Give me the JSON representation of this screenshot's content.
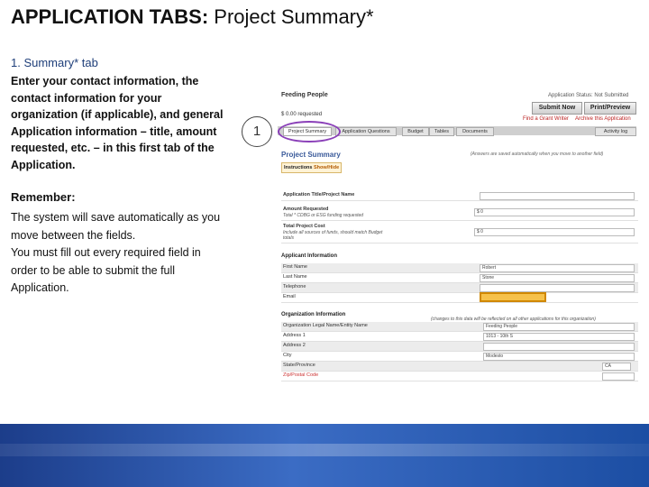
{
  "slide": {
    "title_bold": "APPLICATION TABS:",
    "title_rest": " Project Summary*",
    "subhead": "1. Summary* tab",
    "intro": "Enter your contact information, the contact information for your organization (if applicable), and general Application information – title, amount requested, etc. – in this first tab of the Application.",
    "remember_heading": "Remember:",
    "remember_lines": [
      "The system will save automatically as you move between the fields.",
      "You must fill out every required field in order to be able to submit the full Application."
    ],
    "step_number": "1"
  },
  "app": {
    "org_name": "Feeding People",
    "status": "Application Status: Not Submitted",
    "amount_requested": "$ 0.00 requested",
    "submit_button": "Submit Now",
    "print_button": "Print/Preview",
    "find_writer_link": "Find a Grant Writer",
    "archive_link": "Archive this Application",
    "tabs": [
      "Project Summary",
      "Application Questions",
      "Budget",
      "Tables",
      "Documents"
    ],
    "activity_log": "Activity log",
    "section_title": "Project Summary",
    "autosave_note": "(Answers are saved automatically when you move to another field)",
    "instructions_label": "Instructions",
    "show_hide": "Show/Hide",
    "project_fields": [
      {
        "label": "Application Title/Project Name",
        "sub": "",
        "value": ""
      },
      {
        "label": "Amount Requested",
        "sub": "Total * CDBG or ESG funding requested",
        "value": "$ 0"
      },
      {
        "label": "Total Project Cost",
        "sub": "Include all sources of funds, should match Budget totals",
        "value": "$ 0"
      }
    ],
    "applicant_heading": "Applicant Information",
    "applicant_fields": [
      {
        "label": "First Name",
        "value": "Robert"
      },
      {
        "label": "Last Name",
        "value": "Stone"
      },
      {
        "label": "Telephone",
        "value": ""
      },
      {
        "label": "Email",
        "value": ""
      }
    ],
    "org_heading": "Organization Information",
    "org_note": "(changes to this data will be reflected on all other applications for this organization)",
    "org_fields": [
      {
        "label": "Organization Legal Name/Entity Name",
        "value": "Feeding People"
      },
      {
        "label": "Address 1",
        "value": "1013 - 10th S"
      },
      {
        "label": "Address 2",
        "value": ""
      },
      {
        "label": "City",
        "value": "Modesto"
      },
      {
        "label": "State/Province",
        "value": "CA"
      },
      {
        "label": "Zip/Postal Code",
        "value": ""
      }
    ]
  },
  "colors": {
    "accent_band": "#2a5bb0",
    "highlight_circle": "#8a3fb8",
    "email_highlight": "#f6c14a"
  }
}
